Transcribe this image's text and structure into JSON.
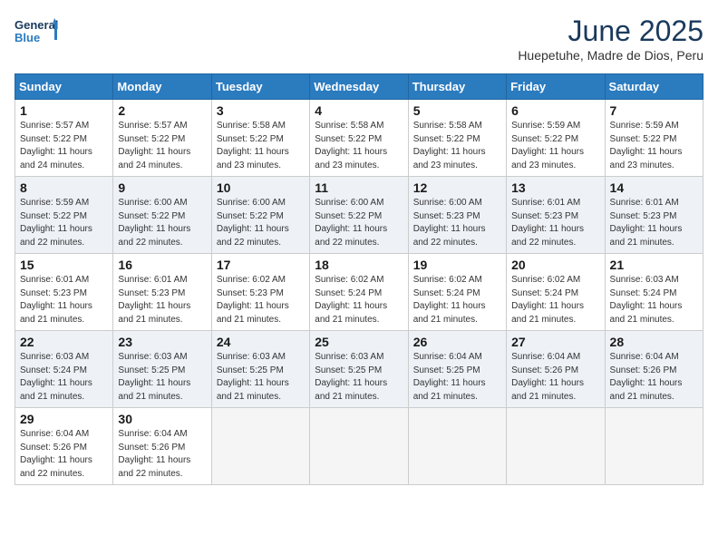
{
  "logo": {
    "line1": "General",
    "line2": "Blue"
  },
  "title": "June 2025",
  "location": "Huepetuhe, Madre de Dios, Peru",
  "weekdays": [
    "Sunday",
    "Monday",
    "Tuesday",
    "Wednesday",
    "Thursday",
    "Friday",
    "Saturday"
  ],
  "weeks": [
    [
      {
        "day": "1",
        "sunrise": "5:57 AM",
        "sunset": "5:22 PM",
        "daylight": "11 hours and 24 minutes."
      },
      {
        "day": "2",
        "sunrise": "5:57 AM",
        "sunset": "5:22 PM",
        "daylight": "11 hours and 24 minutes."
      },
      {
        "day": "3",
        "sunrise": "5:58 AM",
        "sunset": "5:22 PM",
        "daylight": "11 hours and 23 minutes."
      },
      {
        "day": "4",
        "sunrise": "5:58 AM",
        "sunset": "5:22 PM",
        "daylight": "11 hours and 23 minutes."
      },
      {
        "day": "5",
        "sunrise": "5:58 AM",
        "sunset": "5:22 PM",
        "daylight": "11 hours and 23 minutes."
      },
      {
        "day": "6",
        "sunrise": "5:59 AM",
        "sunset": "5:22 PM",
        "daylight": "11 hours and 23 minutes."
      },
      {
        "day": "7",
        "sunrise": "5:59 AM",
        "sunset": "5:22 PM",
        "daylight": "11 hours and 23 minutes."
      }
    ],
    [
      {
        "day": "8",
        "sunrise": "5:59 AM",
        "sunset": "5:22 PM",
        "daylight": "11 hours and 22 minutes."
      },
      {
        "day": "9",
        "sunrise": "6:00 AM",
        "sunset": "5:22 PM",
        "daylight": "11 hours and 22 minutes."
      },
      {
        "day": "10",
        "sunrise": "6:00 AM",
        "sunset": "5:22 PM",
        "daylight": "11 hours and 22 minutes."
      },
      {
        "day": "11",
        "sunrise": "6:00 AM",
        "sunset": "5:22 PM",
        "daylight": "11 hours and 22 minutes."
      },
      {
        "day": "12",
        "sunrise": "6:00 AM",
        "sunset": "5:23 PM",
        "daylight": "11 hours and 22 minutes."
      },
      {
        "day": "13",
        "sunrise": "6:01 AM",
        "sunset": "5:23 PM",
        "daylight": "11 hours and 22 minutes."
      },
      {
        "day": "14",
        "sunrise": "6:01 AM",
        "sunset": "5:23 PM",
        "daylight": "11 hours and 21 minutes."
      }
    ],
    [
      {
        "day": "15",
        "sunrise": "6:01 AM",
        "sunset": "5:23 PM",
        "daylight": "11 hours and 21 minutes."
      },
      {
        "day": "16",
        "sunrise": "6:01 AM",
        "sunset": "5:23 PM",
        "daylight": "11 hours and 21 minutes."
      },
      {
        "day": "17",
        "sunrise": "6:02 AM",
        "sunset": "5:23 PM",
        "daylight": "11 hours and 21 minutes."
      },
      {
        "day": "18",
        "sunrise": "6:02 AM",
        "sunset": "5:24 PM",
        "daylight": "11 hours and 21 minutes."
      },
      {
        "day": "19",
        "sunrise": "6:02 AM",
        "sunset": "5:24 PM",
        "daylight": "11 hours and 21 minutes."
      },
      {
        "day": "20",
        "sunrise": "6:02 AM",
        "sunset": "5:24 PM",
        "daylight": "11 hours and 21 minutes."
      },
      {
        "day": "21",
        "sunrise": "6:03 AM",
        "sunset": "5:24 PM",
        "daylight": "11 hours and 21 minutes."
      }
    ],
    [
      {
        "day": "22",
        "sunrise": "6:03 AM",
        "sunset": "5:24 PM",
        "daylight": "11 hours and 21 minutes."
      },
      {
        "day": "23",
        "sunrise": "6:03 AM",
        "sunset": "5:25 PM",
        "daylight": "11 hours and 21 minutes."
      },
      {
        "day": "24",
        "sunrise": "6:03 AM",
        "sunset": "5:25 PM",
        "daylight": "11 hours and 21 minutes."
      },
      {
        "day": "25",
        "sunrise": "6:03 AM",
        "sunset": "5:25 PM",
        "daylight": "11 hours and 21 minutes."
      },
      {
        "day": "26",
        "sunrise": "6:04 AM",
        "sunset": "5:25 PM",
        "daylight": "11 hours and 21 minutes."
      },
      {
        "day": "27",
        "sunrise": "6:04 AM",
        "sunset": "5:26 PM",
        "daylight": "11 hours and 21 minutes."
      },
      {
        "day": "28",
        "sunrise": "6:04 AM",
        "sunset": "5:26 PM",
        "daylight": "11 hours and 21 minutes."
      }
    ],
    [
      {
        "day": "29",
        "sunrise": "6:04 AM",
        "sunset": "5:26 PM",
        "daylight": "11 hours and 22 minutes."
      },
      {
        "day": "30",
        "sunrise": "6:04 AM",
        "sunset": "5:26 PM",
        "daylight": "11 hours and 22 minutes."
      },
      null,
      null,
      null,
      null,
      null
    ]
  ],
  "labels": {
    "sunrise": "Sunrise:",
    "sunset": "Sunset:",
    "daylight": "Daylight:"
  }
}
